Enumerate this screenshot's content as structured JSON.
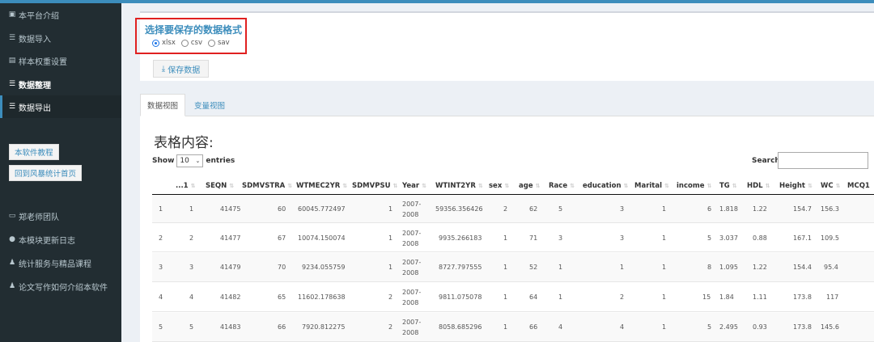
{
  "sidebar": {
    "items": [
      {
        "label": "本平台介绍",
        "icon": "document-icon"
      },
      {
        "label": "数据导入",
        "icon": "database-icon"
      },
      {
        "label": "样本权重设置",
        "icon": "table-icon"
      },
      {
        "label": "数据整理",
        "icon": "database-icon"
      },
      {
        "label": "数据导出",
        "icon": "database-icon"
      }
    ],
    "buttons": [
      "本软件教程",
      "回到风暴统计首页"
    ],
    "lower_items": [
      {
        "label": "郑老师团队",
        "icon": "monitor-icon"
      },
      {
        "label": "本模块更新日志",
        "icon": "info-icon"
      },
      {
        "label": "统计服务与精品课程",
        "icon": "users-icon"
      },
      {
        "label": "论文写作如何介绍本软件",
        "icon": "users-icon"
      }
    ]
  },
  "format_panel": {
    "title": "选择要保存的数据格式",
    "options": [
      "xlsx",
      "csv",
      "sav"
    ],
    "selected": "xlsx",
    "save_button": "保存数据",
    "save_icon": "download-icon"
  },
  "tabs": [
    "数据视图",
    "变量视图"
  ],
  "table": {
    "title": "表格内容:",
    "show_label": "Show",
    "page_size": "10",
    "entries_label": "entries",
    "search_label": "Search:",
    "columns": [
      "...1",
      "SEQN",
      "SDMVSTRA",
      "WTMEC2YR",
      "SDMVPSU",
      "Year",
      "WTINT2YR",
      "sex",
      "age",
      "Race",
      "education",
      "Marital",
      "income",
      "TG",
      "HDL",
      "Height",
      "WC",
      "MCQ1"
    ],
    "rows": [
      {
        "idx": "1",
        "c1": "1",
        "seqn": "41475",
        "sdmvstra": "60",
        "wtmec": "60045.772497",
        "psu": "1",
        "year1": "2007-",
        "year2": "2008",
        "wtint": "59356.356426",
        "sex": "2",
        "age": "62",
        "race": "5",
        "edu": "3",
        "marital": "1",
        "income": "6",
        "tg": "1.818",
        "hdl": "1.22",
        "height": "154.7",
        "wc": "156.3"
      },
      {
        "idx": "2",
        "c1": "2",
        "seqn": "41477",
        "sdmvstra": "67",
        "wtmec": "10074.150074",
        "psu": "1",
        "year1": "2007-",
        "year2": "2008",
        "wtint": "9935.266183",
        "sex": "1",
        "age": "71",
        "race": "3",
        "edu": "3",
        "marital": "1",
        "income": "5",
        "tg": "3.037",
        "hdl": "0.88",
        "height": "167.1",
        "wc": "109.5"
      },
      {
        "idx": "3",
        "c1": "3",
        "seqn": "41479",
        "sdmvstra": "70",
        "wtmec": "9234.055759",
        "psu": "1",
        "year1": "2007-",
        "year2": "2008",
        "wtint": "8727.797555",
        "sex": "1",
        "age": "52",
        "race": "1",
        "edu": "1",
        "marital": "1",
        "income": "8",
        "tg": "1.095",
        "hdl": "1.22",
        "height": "154.4",
        "wc": "95.4"
      },
      {
        "idx": "4",
        "c1": "4",
        "seqn": "41482",
        "sdmvstra": "65",
        "wtmec": "11602.178638",
        "psu": "2",
        "year1": "2007-",
        "year2": "2008",
        "wtint": "9811.075078",
        "sex": "1",
        "age": "64",
        "race": "1",
        "edu": "2",
        "marital": "1",
        "income": "15",
        "tg": "1.84",
        "hdl": "1.11",
        "height": "173.8",
        "wc": "117"
      },
      {
        "idx": "5",
        "c1": "5",
        "seqn": "41483",
        "sdmvstra": "66",
        "wtmec": "7920.812275",
        "psu": "2",
        "year1": "2007-",
        "year2": "2008",
        "wtint": "8058.685296",
        "sex": "1",
        "age": "66",
        "race": "4",
        "edu": "4",
        "marital": "1",
        "income": "5",
        "tg": "2.495",
        "hdl": "0.93",
        "height": "173.8",
        "wc": "145.6"
      }
    ]
  },
  "colors": {
    "accent": "#3c8dbc",
    "sidebar": "#222d32",
    "highlight": "#e02020"
  }
}
